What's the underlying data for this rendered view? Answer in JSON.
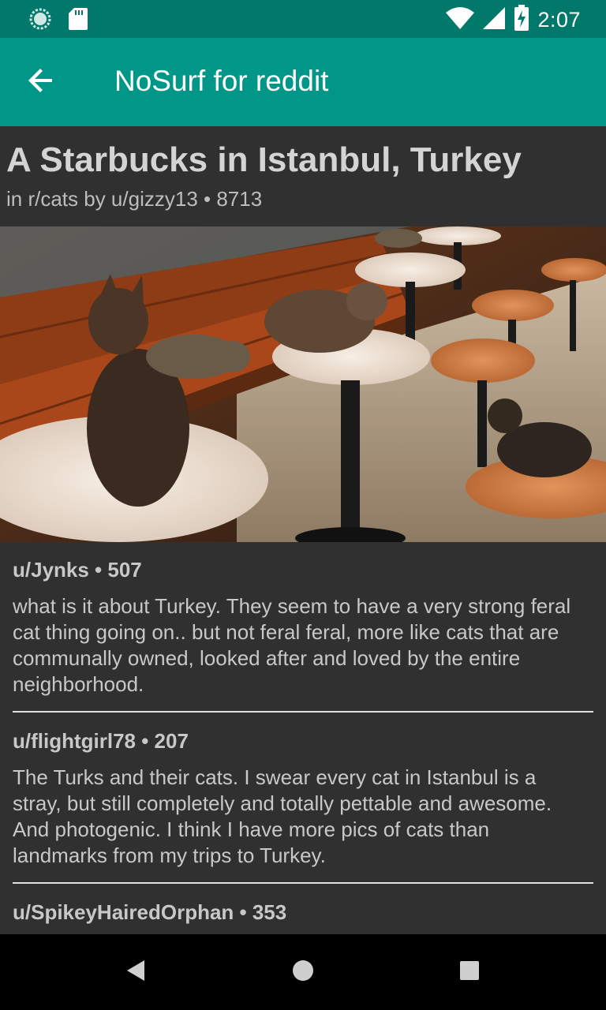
{
  "status_bar": {
    "time": "2:07",
    "icons": [
      "sync-icon",
      "sd-card-icon",
      "wifi-icon",
      "signal-icon",
      "battery-charging-icon"
    ]
  },
  "app_bar": {
    "title": "NoSurf for reddit",
    "back_icon": "arrow-back-icon"
  },
  "post": {
    "title": "A Starbucks in Istanbul, Turkey",
    "meta": "in r/cats by u/gizzy13 • 8713",
    "image_description": "cats-on-starbucks-stools"
  },
  "comments": [
    {
      "header": "u/Jynks • 507",
      "body": "what is it about Turkey. They seem to have a very strong feral cat thing going on.. but not feral feral, more like cats that are communally owned, looked after and loved by the entire neighborhood."
    },
    {
      "header": "u/flightgirl78 • 207",
      "body": "The Turks and their cats. I swear every cat in Istanbul is a stray, but still completely and totally pettable and awesome. And photogenic. I think I have more pics of cats than landmarks from my trips to Turkey."
    },
    {
      "header": "u/SpikeyHairedOrphan • 353",
      "body": ""
    }
  ],
  "nav_bar": {
    "icons": [
      "back-triangle-icon",
      "home-circle-icon",
      "recents-square-icon"
    ]
  },
  "colors": {
    "status_bar": "#00796b",
    "app_bar": "#009688",
    "background": "#303030",
    "text": "#c8c8c8"
  }
}
